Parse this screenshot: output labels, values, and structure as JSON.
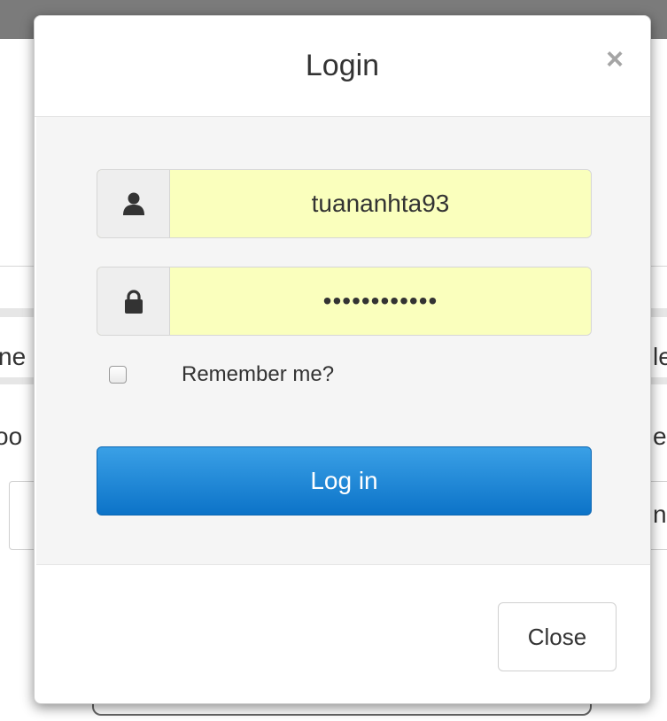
{
  "modal": {
    "title": "Login",
    "close_glyph": "×"
  },
  "form": {
    "username": {
      "icon": "user-icon",
      "value": "tuananhta93"
    },
    "password": {
      "icon": "lock-icon",
      "value": "••••••••••••"
    },
    "remember_label": "Remember me?",
    "remember_checked": false,
    "login_label": "Log in"
  },
  "footer": {
    "close_label": "Close"
  },
  "background": {
    "fragments": [
      "ne",
      "le",
      "oo",
      "e",
      "n"
    ]
  },
  "colors": {
    "autofill": "#faffbd",
    "primary_button": "#1a85d6",
    "overlay": "#7b7b7b"
  }
}
